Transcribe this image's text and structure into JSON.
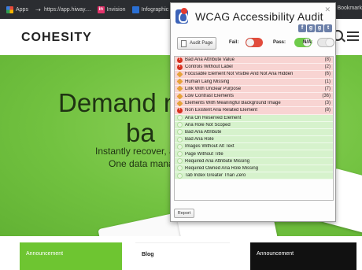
{
  "bookmarks": {
    "items": [
      {
        "label": "Apps"
      },
      {
        "label": "https://app.hiway...."
      },
      {
        "label": "Invision"
      },
      {
        "label": "Infographic"
      }
    ],
    "overflow_label": "r Bookmark"
  },
  "site": {
    "logo": "COHESITY",
    "hero_line1": "Demand m",
    "hero_line2": "ba",
    "hero_sub1": "Instantly recover, a",
    "hero_sub2": "One data manage"
  },
  "bottom_cards": [
    {
      "label": "Announcement"
    },
    {
      "label": "Blog"
    },
    {
      "label": "Announcement"
    }
  ],
  "popup": {
    "title": "WCAG Accessibility Audit",
    "social": [
      "f",
      "g",
      "g",
      "t"
    ],
    "audit_button": "Audit Page",
    "fail_label": "Fail:",
    "pass_label": "Pass:",
    "na_label": "N/A:",
    "issues": [
      {
        "label": "Bad Aria Attribute Value",
        "count": "(8)",
        "status": "fail",
        "icon": "error-icon"
      },
      {
        "label": "Controls Without Label",
        "count": "(2)",
        "status": "fail",
        "icon": "error-icon"
      },
      {
        "label": "Focusable Element Not Visible And Not Aria Hidden",
        "count": "(6)",
        "status": "fail",
        "icon": "warning-icon"
      },
      {
        "label": "Human Lang Missing",
        "count": "(1)",
        "status": "fail",
        "icon": "warning-icon"
      },
      {
        "label": "Link With Unclear Purpose",
        "count": "(7)",
        "status": "fail",
        "icon": "warning-icon"
      },
      {
        "label": "Low Contrast Elements",
        "count": "(36)",
        "status": "fail",
        "icon": "warning-icon"
      },
      {
        "label": "Elements With Meaningful Background Image",
        "count": "(3)",
        "status": "fail",
        "icon": "warning-icon"
      },
      {
        "label": "Non Existent Aria Related Element",
        "count": "(8)",
        "status": "fail",
        "icon": "error-icon"
      },
      {
        "label": "Aria On Reserved Element",
        "count": "",
        "status": "pass",
        "icon": "pass-icon"
      },
      {
        "label": "Aria Role Not Scoped",
        "count": "",
        "status": "pass",
        "icon": "pass-icon"
      },
      {
        "label": "Bad Aria Attribute",
        "count": "",
        "status": "pass",
        "icon": "pass-icon"
      },
      {
        "label": "Bad Aria Role",
        "count": "",
        "status": "pass",
        "icon": "pass-icon"
      },
      {
        "label": "Images Without Alt Text",
        "count": "",
        "status": "pass",
        "icon": "pass-icon"
      },
      {
        "label": "Page Without Title",
        "count": "",
        "status": "pass",
        "icon": "pass-icon"
      },
      {
        "label": "Required Aria Attribute Missing",
        "count": "",
        "status": "pass",
        "icon": "pass-icon"
      },
      {
        "label": "Required Owned Aria Role Missing",
        "count": "",
        "status": "pass",
        "icon": "pass-icon"
      },
      {
        "label": "Tab Index Greater Than Zero",
        "count": "",
        "status": "pass",
        "icon": "pass-icon"
      }
    ],
    "report_button": "Report"
  },
  "colors": {
    "brand_green": "#6ec531",
    "fail_row": "#f8d4d2",
    "pass_row": "#d6f2cc",
    "fail_toggle": "#e24c3c",
    "pass_toggle": "#6ecb4a"
  }
}
